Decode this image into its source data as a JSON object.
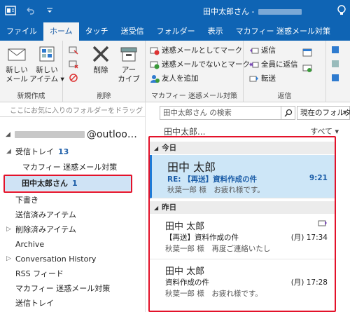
{
  "window": {
    "title": "田中太郎さん -"
  },
  "ribbon_tabs": [
    "ファイル",
    "ホーム",
    "タッチ",
    "送受信",
    "フォルダー",
    "表示",
    "マカフィー 迷惑メール対策"
  ],
  "ribbon": {
    "new_group": {
      "label": "新規作成",
      "new_mail": "新しい\nメール",
      "new_items": "新しい\nアイテム ▾"
    },
    "delete_group": {
      "label": "削除",
      "delete": "削除",
      "archive": "アー\nカイブ"
    },
    "mcafee_group": {
      "label": "マカフィー 迷惑メール対策",
      "mark_spam": "迷惑メールとしてマーク",
      "mark_not_spam": "迷惑メールでないとマーク",
      "add_friend": "友人を追加"
    },
    "reply_group": {
      "label": "返信",
      "reply": "返信",
      "reply_all": "全員に返信",
      "forward": "転送"
    }
  },
  "folder_pane": {
    "favorites_hint": "ここにお気に入りのフォルダーをドラッグしま",
    "account_suffix": "@outloo…",
    "folders": [
      {
        "name": "受信トレイ",
        "count": "13",
        "expanded": true
      },
      {
        "name": "マカフィー 迷惑メール対策",
        "count": ""
      },
      {
        "name": "田中太郎さん",
        "count": "1"
      },
      {
        "name": "下書き",
        "count": ""
      },
      {
        "name": "送信済みアイテム",
        "count": ""
      },
      {
        "name": "削除済みアイテム",
        "count": ""
      },
      {
        "name": "Archive",
        "count": ""
      },
      {
        "name": "Conversation History",
        "count": ""
      },
      {
        "name": "RSS フィード",
        "count": ""
      },
      {
        "name": "マカフィー 迷惑メール対策",
        "count": ""
      },
      {
        "name": "送信トレイ",
        "count": ""
      }
    ]
  },
  "message_list": {
    "search_placeholder": "田中太郎さん の検索",
    "scope": "現在のフォルダー",
    "owner": "田中太郎...",
    "filter": "すべて ▾",
    "groups": [
      {
        "header": "今日",
        "messages": [
          {
            "sender": "田中 太郎",
            "subject": "RE: 【再送】資料作成の件",
            "preview": "秋葉一郎 様　お疲れ様です。",
            "time": "9:21"
          }
        ]
      },
      {
        "header": "昨日",
        "messages": [
          {
            "sender": "田中 太郎",
            "subject": "【再送】資料作成の件",
            "preview": "秋葉一郎 様　再度ご連絡いたし",
            "time": "(月) 17:34"
          },
          {
            "sender": "田中 太郎",
            "subject": "資料作成の件",
            "preview": "秋葉一郎 様　お疲れ様です。",
            "time": "(月) 17:28"
          }
        ]
      }
    ]
  },
  "colors": {
    "accent": "#0f64b4",
    "highlight": "#e3122a",
    "selection": "#cde6f7"
  }
}
